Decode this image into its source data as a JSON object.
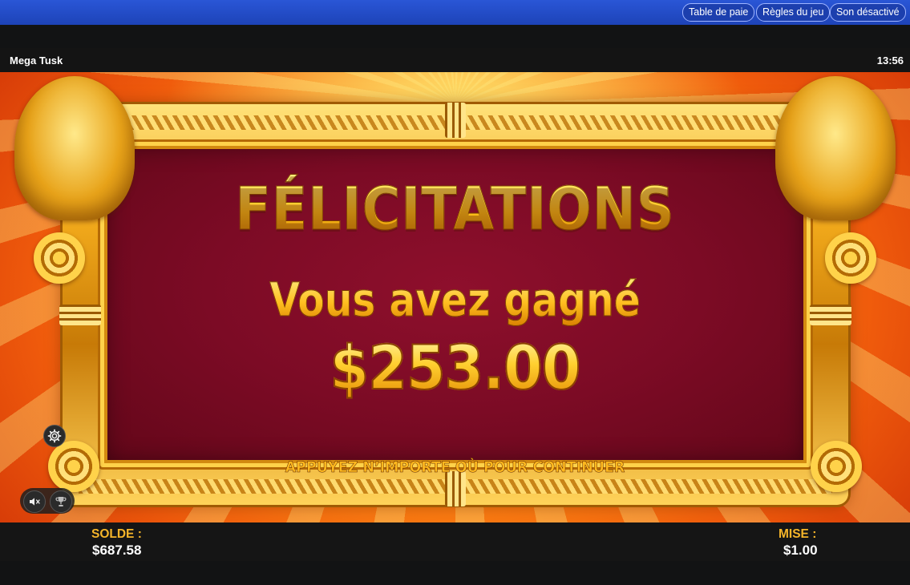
{
  "header": {
    "buttons": [
      {
        "label": "Table de paie"
      },
      {
        "label": "Règles du jeu"
      },
      {
        "label": "Son désactivé"
      }
    ]
  },
  "game": {
    "title": "Mega Tusk",
    "clock": "13:56"
  },
  "win": {
    "heading": "FÉLICITATIONS",
    "subheading": "Vous avez gagné",
    "amount": "$253.00",
    "continue_prompt": "APPUYEZ N’IMPORTE OÙ POUR CONTINUER"
  },
  "controls": {
    "settings_icon": "gear-icon",
    "sound_icon": "speaker-muted-icon",
    "trophy_icon": "trophy-icon"
  },
  "footer": {
    "balance_label": "SOLDE :",
    "balance_value": "$687.58",
    "bet_label": "MISE :",
    "bet_value": "$1.00"
  },
  "colors": {
    "top_bar": "#2250cc",
    "panel": "#7c0b25",
    "gold": "#ffca2a",
    "label_gold": "#f5b52a"
  }
}
